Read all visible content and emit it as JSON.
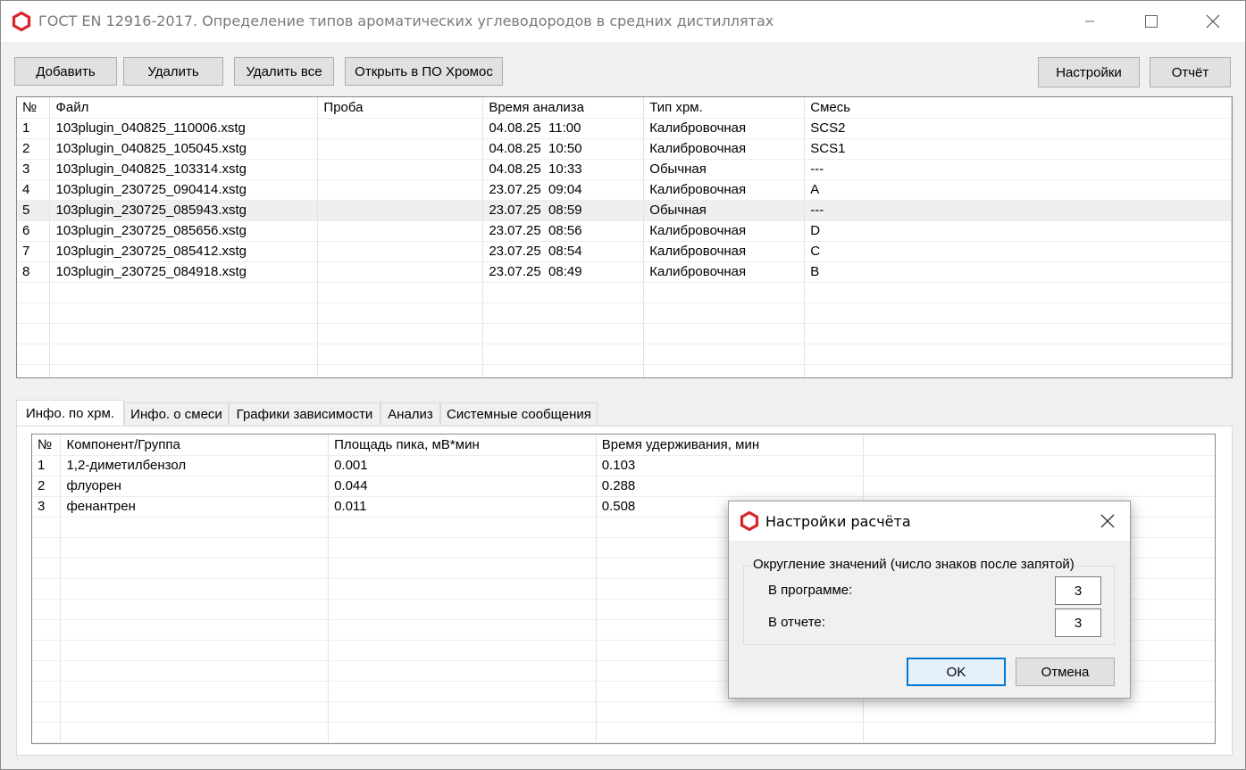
{
  "window": {
    "title": "ГОСТ EN 12916-2017. Определение типов ароматических углеводородов в средних дистиллятах"
  },
  "toolbar": {
    "add": "Добавить",
    "delete": "Удалить",
    "delete_all": "Удалить все",
    "open_chromos": "Открыть в ПО Хромос",
    "settings": "Настройки",
    "report": "Отчёт"
  },
  "files_table": {
    "headers": [
      "№",
      "Файл",
      "Проба",
      "Время анализа",
      "Тип хрм.",
      "Смесь"
    ],
    "rows": [
      [
        "1",
        "103plugin_040825_110006.xstg",
        "",
        "04.08.25  11:00",
        "Калибровочная",
        "SCS2"
      ],
      [
        "2",
        "103plugin_040825_105045.xstg",
        "",
        "04.08.25  10:50",
        "Калибровочная",
        "SCS1"
      ],
      [
        "3",
        "103plugin_040825_103314.xstg",
        "",
        "04.08.25  10:33",
        "Обычная",
        "---"
      ],
      [
        "4",
        "103plugin_230725_090414.xstg",
        "",
        "23.07.25  09:04",
        "Калибровочная",
        "A"
      ],
      [
        "5",
        "103plugin_230725_085943.xstg",
        "",
        "23.07.25  08:59",
        "Обычная",
        "---"
      ],
      [
        "6",
        "103plugin_230725_085656.xstg",
        "",
        "23.07.25  08:56",
        "Калибровочная",
        "D"
      ],
      [
        "7",
        "103plugin_230725_085412.xstg",
        "",
        "23.07.25  08:54",
        "Калибровочная",
        "C"
      ],
      [
        "8",
        "103plugin_230725_084918.xstg",
        "",
        "23.07.25  08:49",
        "Калибровочная",
        "B"
      ]
    ],
    "selected_row": 5
  },
  "tabs": [
    "Инфо. по хрм.",
    "Инфо. о смеси",
    "Графики зависимости",
    "Анализ",
    "Системные сообщения"
  ],
  "components_table": {
    "headers": [
      "№",
      "Компонент/Группа",
      "Площадь пика, мВ*мин",
      "Время удерживания, мин"
    ],
    "rows": [
      [
        "1",
        "1,2-диметилбензол",
        "0.001",
        "0.103"
      ],
      [
        "2",
        "флуорен",
        "0.044",
        "0.288"
      ],
      [
        "3",
        "фенантрен",
        "0.011",
        "0.508"
      ]
    ]
  },
  "dialog": {
    "title": "Настройки расчёта",
    "group_title": "Округление значений (число знаков после запятой)",
    "in_program_label": "В программе:",
    "in_program_value": "3",
    "in_report_label": "В отчете:",
    "in_report_value": "3",
    "ok": "OK",
    "cancel": "Отмена"
  },
  "colors": {
    "app_icon": "#d9242b",
    "selected_row": "#efefef",
    "ok_border": "#0078d7"
  }
}
